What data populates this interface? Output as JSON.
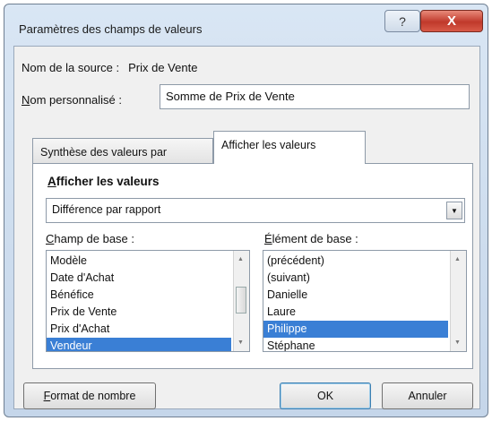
{
  "window": {
    "title": "Paramètres des champs de valeurs",
    "help_label": "?",
    "close_label": "X"
  },
  "source": {
    "label": "Nom de la source :",
    "value": "Prix de Vente"
  },
  "custom_name": {
    "label_accel": "N",
    "label_rest": "om personnalisé :",
    "value": "Somme de Prix de Vente"
  },
  "tabs": [
    {
      "label": "Synthèse des valeurs par",
      "active": false
    },
    {
      "label": "Afficher les valeurs",
      "active": true
    }
  ],
  "panel": {
    "heading_accel": "A",
    "heading_rest": "fficher les valeurs",
    "calc_value": "Différence par rapport",
    "base_field": {
      "label_accel": "C",
      "label_rest": "hamp de base :",
      "items": [
        "Modèle",
        "Date d'Achat",
        "Bénéfice",
        "Prix de Vente",
        "Prix d'Achat",
        "Vendeur"
      ],
      "selected_index": 5
    },
    "base_item": {
      "label_accel": "É",
      "label_rest": "lément de base :",
      "items": [
        "(précédent)",
        "(suivant)",
        "Danielle",
        "Laure",
        "Philippe",
        "Stéphane"
      ],
      "selected_index": 4
    }
  },
  "buttons": {
    "number_format_accel": "F",
    "number_format_rest": "ormat de nombre",
    "ok": "OK",
    "cancel": "Annuler"
  }
}
